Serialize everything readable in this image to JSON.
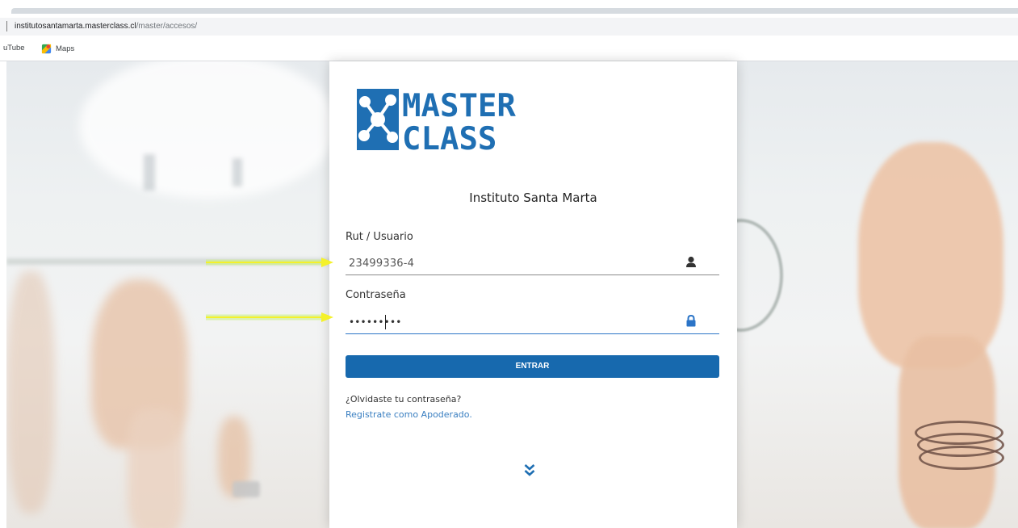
{
  "browser": {
    "url_host": "institutosantamarta.masterclass.cl",
    "url_path": "/master/accesos/",
    "bookmarks": [
      {
        "label": "uTube",
        "icon": "youtube-icon"
      },
      {
        "label": "Maps",
        "icon": "google-maps-icon"
      }
    ]
  },
  "logo": {
    "line1": "MASTER",
    "line2": "CLASS",
    "color": "#1f6fb3"
  },
  "login": {
    "institution": "Instituto Santa Marta",
    "user_label": "Rut / Usuario",
    "user_value": "23499336-4",
    "user_icon": "user-icon",
    "password_label": "Contraseña",
    "password_value": "•••••••••",
    "password_icon": "lock-icon",
    "submit_label": "ENTRAR",
    "forgot_link": "¿Olvidaste tu contraseña?",
    "register_link": "Registrate como Apoderado.",
    "scroll_icon": "double-chevron-down-icon"
  },
  "colors": {
    "primary": "#1769ae",
    "link": "#3a7fc1",
    "annotation_arrow": "#f4f12a"
  }
}
